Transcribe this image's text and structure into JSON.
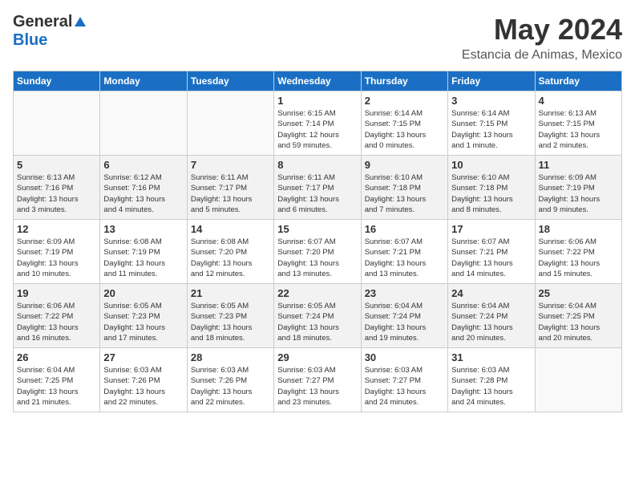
{
  "header": {
    "logo_general": "General",
    "logo_blue": "Blue",
    "month_title": "May 2024",
    "location": "Estancia de Animas, Mexico"
  },
  "calendar": {
    "days_of_week": [
      "Sunday",
      "Monday",
      "Tuesday",
      "Wednesday",
      "Thursday",
      "Friday",
      "Saturday"
    ],
    "weeks": [
      [
        {
          "day": "",
          "info": ""
        },
        {
          "day": "",
          "info": ""
        },
        {
          "day": "",
          "info": ""
        },
        {
          "day": "1",
          "info": "Sunrise: 6:15 AM\nSunset: 7:14 PM\nDaylight: 12 hours\nand 59 minutes."
        },
        {
          "day": "2",
          "info": "Sunrise: 6:14 AM\nSunset: 7:15 PM\nDaylight: 13 hours\nand 0 minutes."
        },
        {
          "day": "3",
          "info": "Sunrise: 6:14 AM\nSunset: 7:15 PM\nDaylight: 13 hours\nand 1 minute."
        },
        {
          "day": "4",
          "info": "Sunrise: 6:13 AM\nSunset: 7:15 PM\nDaylight: 13 hours\nand 2 minutes."
        }
      ],
      [
        {
          "day": "5",
          "info": "Sunrise: 6:13 AM\nSunset: 7:16 PM\nDaylight: 13 hours\nand 3 minutes."
        },
        {
          "day": "6",
          "info": "Sunrise: 6:12 AM\nSunset: 7:16 PM\nDaylight: 13 hours\nand 4 minutes."
        },
        {
          "day": "7",
          "info": "Sunrise: 6:11 AM\nSunset: 7:17 PM\nDaylight: 13 hours\nand 5 minutes."
        },
        {
          "day": "8",
          "info": "Sunrise: 6:11 AM\nSunset: 7:17 PM\nDaylight: 13 hours\nand 6 minutes."
        },
        {
          "day": "9",
          "info": "Sunrise: 6:10 AM\nSunset: 7:18 PM\nDaylight: 13 hours\nand 7 minutes."
        },
        {
          "day": "10",
          "info": "Sunrise: 6:10 AM\nSunset: 7:18 PM\nDaylight: 13 hours\nand 8 minutes."
        },
        {
          "day": "11",
          "info": "Sunrise: 6:09 AM\nSunset: 7:19 PM\nDaylight: 13 hours\nand 9 minutes."
        }
      ],
      [
        {
          "day": "12",
          "info": "Sunrise: 6:09 AM\nSunset: 7:19 PM\nDaylight: 13 hours\nand 10 minutes."
        },
        {
          "day": "13",
          "info": "Sunrise: 6:08 AM\nSunset: 7:19 PM\nDaylight: 13 hours\nand 11 minutes."
        },
        {
          "day": "14",
          "info": "Sunrise: 6:08 AM\nSunset: 7:20 PM\nDaylight: 13 hours\nand 12 minutes."
        },
        {
          "day": "15",
          "info": "Sunrise: 6:07 AM\nSunset: 7:20 PM\nDaylight: 13 hours\nand 13 minutes."
        },
        {
          "day": "16",
          "info": "Sunrise: 6:07 AM\nSunset: 7:21 PM\nDaylight: 13 hours\nand 13 minutes."
        },
        {
          "day": "17",
          "info": "Sunrise: 6:07 AM\nSunset: 7:21 PM\nDaylight: 13 hours\nand 14 minutes."
        },
        {
          "day": "18",
          "info": "Sunrise: 6:06 AM\nSunset: 7:22 PM\nDaylight: 13 hours\nand 15 minutes."
        }
      ],
      [
        {
          "day": "19",
          "info": "Sunrise: 6:06 AM\nSunset: 7:22 PM\nDaylight: 13 hours\nand 16 minutes."
        },
        {
          "day": "20",
          "info": "Sunrise: 6:05 AM\nSunset: 7:23 PM\nDaylight: 13 hours\nand 17 minutes."
        },
        {
          "day": "21",
          "info": "Sunrise: 6:05 AM\nSunset: 7:23 PM\nDaylight: 13 hours\nand 18 minutes."
        },
        {
          "day": "22",
          "info": "Sunrise: 6:05 AM\nSunset: 7:24 PM\nDaylight: 13 hours\nand 18 minutes."
        },
        {
          "day": "23",
          "info": "Sunrise: 6:04 AM\nSunset: 7:24 PM\nDaylight: 13 hours\nand 19 minutes."
        },
        {
          "day": "24",
          "info": "Sunrise: 6:04 AM\nSunset: 7:24 PM\nDaylight: 13 hours\nand 20 minutes."
        },
        {
          "day": "25",
          "info": "Sunrise: 6:04 AM\nSunset: 7:25 PM\nDaylight: 13 hours\nand 20 minutes."
        }
      ],
      [
        {
          "day": "26",
          "info": "Sunrise: 6:04 AM\nSunset: 7:25 PM\nDaylight: 13 hours\nand 21 minutes."
        },
        {
          "day": "27",
          "info": "Sunrise: 6:03 AM\nSunset: 7:26 PM\nDaylight: 13 hours\nand 22 minutes."
        },
        {
          "day": "28",
          "info": "Sunrise: 6:03 AM\nSunset: 7:26 PM\nDaylight: 13 hours\nand 22 minutes."
        },
        {
          "day": "29",
          "info": "Sunrise: 6:03 AM\nSunset: 7:27 PM\nDaylight: 13 hours\nand 23 minutes."
        },
        {
          "day": "30",
          "info": "Sunrise: 6:03 AM\nSunset: 7:27 PM\nDaylight: 13 hours\nand 24 minutes."
        },
        {
          "day": "31",
          "info": "Sunrise: 6:03 AM\nSunset: 7:28 PM\nDaylight: 13 hours\nand 24 minutes."
        },
        {
          "day": "",
          "info": ""
        }
      ]
    ]
  }
}
